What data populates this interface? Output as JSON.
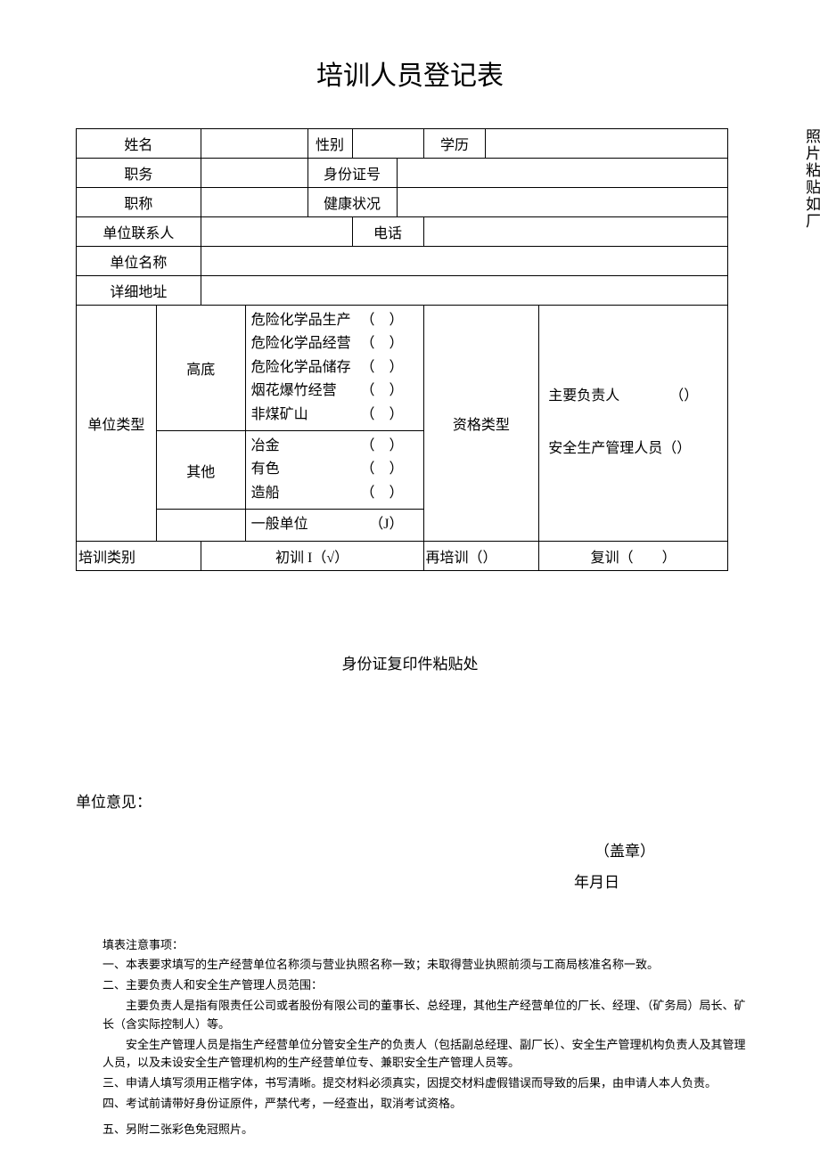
{
  "title": "培训人员登记表",
  "labels": {
    "name": "姓名",
    "gender": "性别",
    "education": "学历",
    "position": "职务",
    "id_no": "身份证号",
    "title_rank": "职称",
    "health": "健康状况",
    "unit_contact": "单位联系人",
    "phone": "电话",
    "unit_name": "单位名称",
    "address": "详细地址",
    "unit_type": "单位类型",
    "qual_type": "资格类型",
    "training_cat": "培训类别",
    "photo": "照片粘贴如厂"
  },
  "unit_type_groups": {
    "g1_label": "高底",
    "g1_items": [
      {
        "name": "危险化学品生产",
        "paren": "（　）"
      },
      {
        "name": "危险化学品经营",
        "paren": "（　）"
      },
      {
        "name": "危险化学品储存",
        "paren": "（　）"
      },
      {
        "name": "烟花爆竹经营",
        "paren": "（　）"
      },
      {
        "name": "非煤矿山",
        "paren": "（　）"
      }
    ],
    "g2_label": "其他",
    "g2_items": [
      {
        "name": "冶金",
        "paren": "（　）"
      },
      {
        "name": "有色",
        "paren": "（　）"
      },
      {
        "name": "造船",
        "paren": "（　）"
      }
    ],
    "g3_items": [
      {
        "name": "一般单位",
        "paren": "（J）"
      }
    ]
  },
  "qual_items": {
    "a": "主要负责人　　　　（）",
    "b": "安全生产管理人员（）"
  },
  "training": {
    "initial": "初训 I（√）",
    "retrain": "再培训（）",
    "review": "复训（　　）"
  },
  "id_copy_area": "身份证复印件粘贴处",
  "opinion": {
    "label": "单位意见：",
    "stamp": "（盖章）",
    "date": "年月日"
  },
  "notes": {
    "header": "填表注意事项：",
    "n1": "一、本表要求填写的生产经营单位名称须与营业执照名称一致；未取得营业执照前须与工商局核准名称一致。",
    "n2": "二、主要负责人和安全生产管理人员范围：",
    "n2a": "主要负责人是指有限责任公司或者股份有限公司的董事长、总经理，其他生产经营单位的厂长、经理、（矿务局）局长、矿长（含实际控制人）等。",
    "n2b": "安全生产管理人员是指生产经营单位分管安全生产的负责人（包括副总经理、副厂长）、安全生产管理机构负责人及其管理人员，以及未设安全生产管理机构的生产经营单位专、兼职安全生产管理人员等。",
    "n3": "三、申请人填写须用正楷字体，书写清晰。提交材料必须真实，因提交材料虚假错误而导致的后果，由申请人本人负责。",
    "n4": "四、考试前请带好身份证原件，严禁代考，一经查出，取消考试资格。",
    "n5": "五、另附二张彩色免冠照片。"
  }
}
